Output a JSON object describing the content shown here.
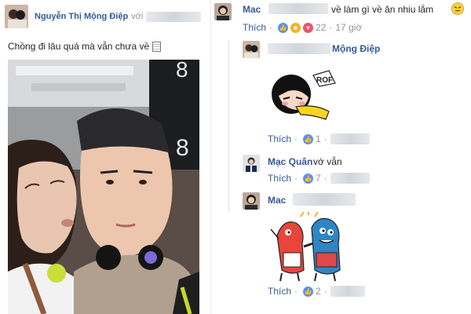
{
  "post": {
    "author": "Nguyễn Thị Mộng Điệp",
    "author_suffix": "với",
    "text": "Chồng đi lâu quá mà vẫn chưa về"
  },
  "comments": [
    {
      "name": "Mac",
      "text": "về làm gì về ăn nhiu lắm",
      "like_label": "Thích",
      "reaction_count": "22",
      "time": "17 giờ"
    },
    {
      "name": "Mộng Điệp",
      "like_label": "Thích",
      "reaction_count": "1"
    },
    {
      "name": "Mạc Quân",
      "text": "vớ vẫn",
      "like_label": "Thích",
      "reaction_count": "7"
    },
    {
      "name": "Mac",
      "like_label": "Thích",
      "reaction_count": "2"
    }
  ],
  "sticker_texts": {
    "bubble": "ROF"
  },
  "colors": {
    "link": "#365899",
    "like_blue": "#5890ff",
    "love_red": "#f25268",
    "haha_yellow": "#f7b125"
  },
  "icons": [
    "like-icon",
    "haha-icon",
    "love-icon",
    "emoji-icon"
  ]
}
